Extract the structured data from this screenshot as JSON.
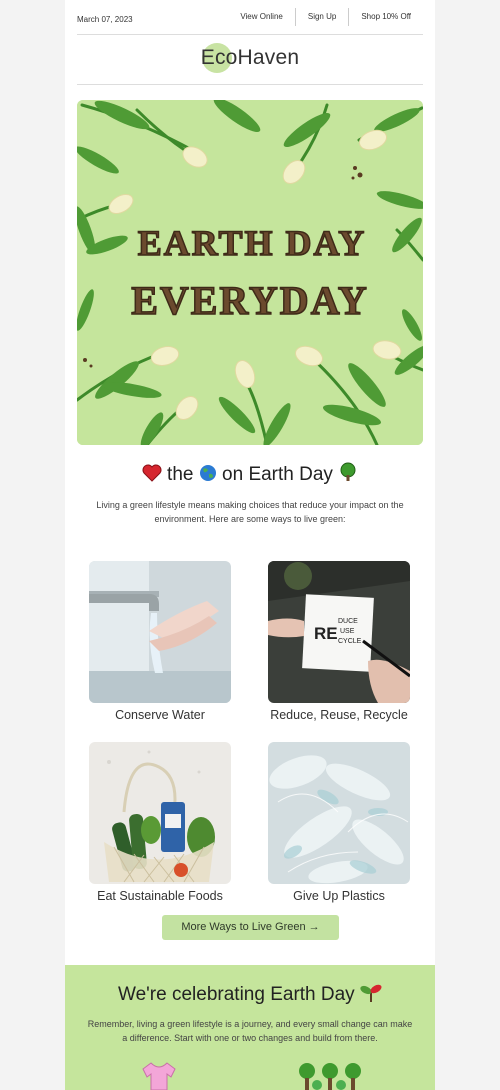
{
  "topbar": {
    "date": "March 07, 2023",
    "links": [
      "View Online",
      "Sign Up",
      "Shop 10% Off"
    ]
  },
  "logo": "EcoHaven",
  "hero": {
    "line1": "EARTH DAY",
    "line2": "EVERYDAY"
  },
  "headline": {
    "pre": "the",
    "post": "on Earth Day",
    "icons": [
      "heart-icon",
      "globe-icon",
      "tree-icon"
    ]
  },
  "intro": "Living a green lifestyle means making choices that reduce your impact on the environment. Here are some ways to live green:",
  "cards": [
    {
      "label": "Conserve Water"
    },
    {
      "label": "Reduce, Reuse, Recycle"
    },
    {
      "label": "Eat Sustainable Foods"
    },
    {
      "label": "Give Up Plastics"
    }
  ],
  "recycle_note": [
    "RE",
    "DUCE",
    "USE",
    "CYCLE"
  ],
  "cta": "More Ways to Live Green →",
  "celebrate": {
    "title": "We're celebrating Earth Day",
    "body": "Remember, living a green lifestyle is a journey, and every small change can make a difference. Start with one or two changes and build from there."
  },
  "colors": {
    "accent": "#c3e2a1",
    "hero_bg": "#c5e59c"
  }
}
